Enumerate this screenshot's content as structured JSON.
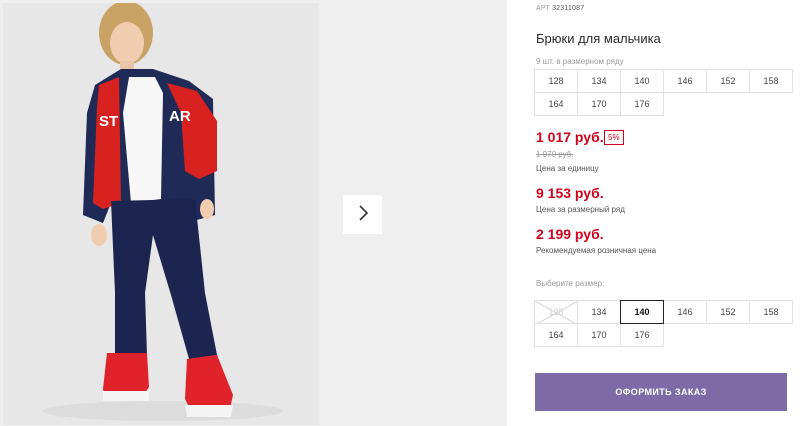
{
  "product": {
    "article_label": "АРТ",
    "article_value": "32311087",
    "title": "Брюки для мальчика",
    "range_label": "9 шт. в размерном ряду"
  },
  "size_range": [
    "128",
    "134",
    "140",
    "146",
    "152",
    "158",
    "164",
    "170",
    "176"
  ],
  "pricing": {
    "unit_price": "1 017 руб.",
    "discount": "5%",
    "old_price": "1 070 руб.",
    "unit_note": "Цена за единицу",
    "range_price": "9 153 руб.",
    "range_note": "Цена за размерный ряд",
    "retail_price": "2 199 руб.",
    "retail_note": "Рекомендуемая розничная цена"
  },
  "size_picker": {
    "label": "Выберите размер:",
    "sizes": [
      "128",
      "134",
      "140",
      "146",
      "152",
      "158",
      "164",
      "170",
      "176"
    ],
    "selected": "140",
    "disabled": "128"
  },
  "order_button": "ОФОРМИТЬ ЗАКАЗ",
  "colors": {
    "price_red": "#d0021b",
    "order_purple": "#7e6aa6",
    "jacket_navy": "#1f2a56",
    "jacket_red": "#d8221f"
  },
  "icons": {
    "next": "chevron-right-icon",
    "disabled_size": "cross-out-icon"
  }
}
